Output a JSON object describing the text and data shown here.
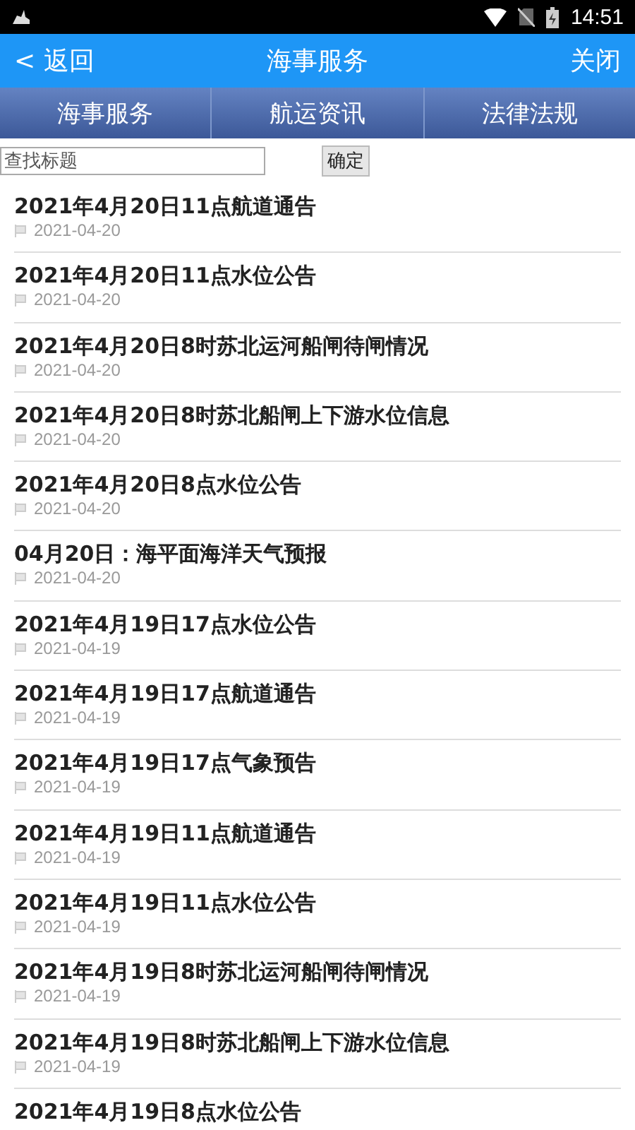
{
  "status_bar": {
    "time": "14:51"
  },
  "header": {
    "back": "< 返回",
    "title": "海事服务",
    "close": "关闭"
  },
  "tabs": [
    {
      "label": "海事服务",
      "selected": false
    },
    {
      "label": "航运资讯",
      "selected": false
    },
    {
      "label": "法律法规",
      "selected": false
    }
  ],
  "search": {
    "placeholder": "查找标题",
    "button": "确定"
  },
  "items": [
    {
      "title": "2021年4月20日11点航道通告",
      "date": "2021-04-20"
    },
    {
      "title": "2021年4月20日11点水位公告",
      "date": "2021-04-20"
    },
    {
      "title": "2021年4月20日8时苏北运河船闸待闸情况",
      "date": "2021-04-20"
    },
    {
      "title": "2021年4月20日8时苏北船闸上下游水位信息",
      "date": "2021-04-20"
    },
    {
      "title": "2021年4月20日8点水位公告",
      "date": "2021-04-20"
    },
    {
      "title": "04月20日：海平面海洋天气预报",
      "date": "2021-04-20"
    },
    {
      "title": "2021年4月19日17点水位公告",
      "date": "2021-04-19"
    },
    {
      "title": "2021年4月19日17点航道通告",
      "date": "2021-04-19"
    },
    {
      "title": "2021年4月19日17点气象预告",
      "date": "2021-04-19"
    },
    {
      "title": "2021年4月19日11点航道通告",
      "date": "2021-04-19"
    },
    {
      "title": "2021年4月19日11点水位公告",
      "date": "2021-04-19"
    },
    {
      "title": "2021年4月19日8时苏北运河船闸待闸情况",
      "date": "2021-04-19"
    },
    {
      "title": "2021年4月19日8时苏北船闸上下游水位信息",
      "date": "2021-04-19"
    },
    {
      "title": "2021年4月19日8点水位公告"
    }
  ]
}
